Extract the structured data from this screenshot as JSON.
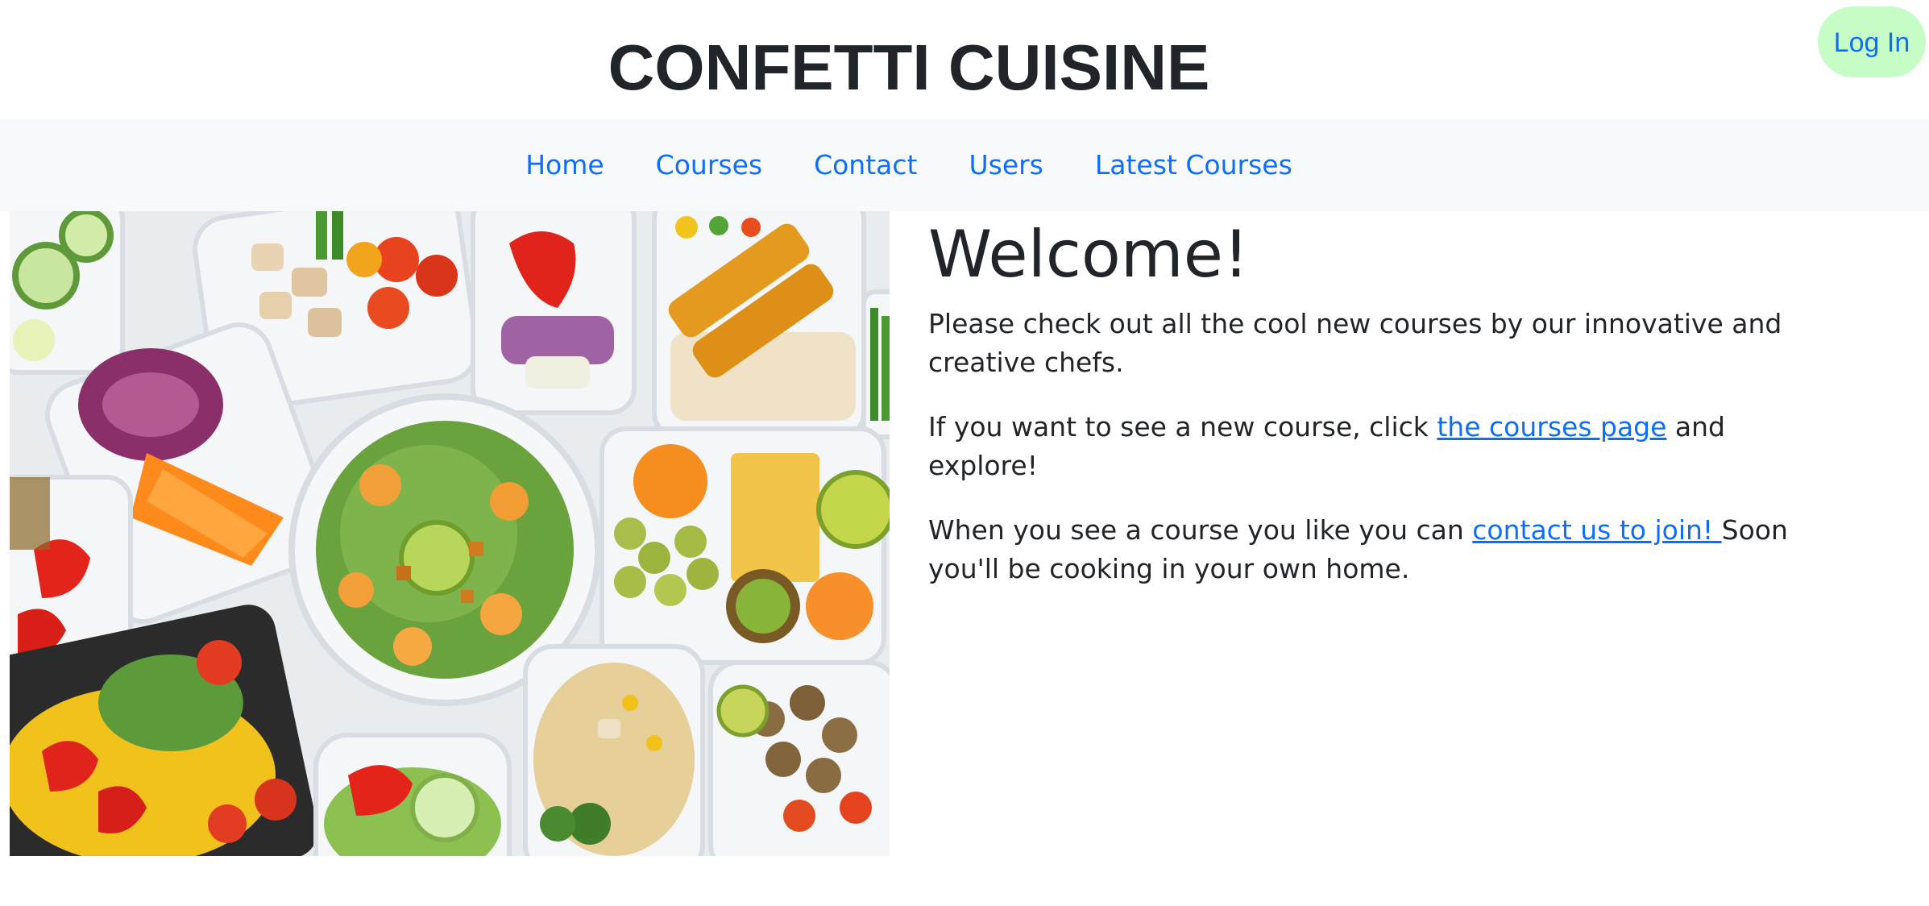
{
  "header": {
    "site_title": "CONFETTI CUISINE",
    "login_label": "Log In"
  },
  "nav": {
    "items": [
      {
        "label": "Home"
      },
      {
        "label": "Courses"
      },
      {
        "label": "Contact"
      },
      {
        "label": "Users"
      },
      {
        "label": "Latest Courses"
      }
    ]
  },
  "hero": {
    "image_subject": "meal-prep-containers-photo"
  },
  "main": {
    "heading": "Welcome!",
    "para1": "Please check out all the cool new courses by our innovative and creative chefs.",
    "para2_before": "If you want to see a new course, click ",
    "para2_link": "the courses page",
    "para2_after": " and explore!",
    "para3_before": "When you see a course you like you can ",
    "para3_link": "contact us to join! ",
    "para3_after": "Soon you'll be cooking in your own home."
  },
  "colors": {
    "link": "#0d6efd",
    "login_bg": "#c6fcc6",
    "navbar_bg": "#f8f9fa",
    "text": "#212529"
  }
}
